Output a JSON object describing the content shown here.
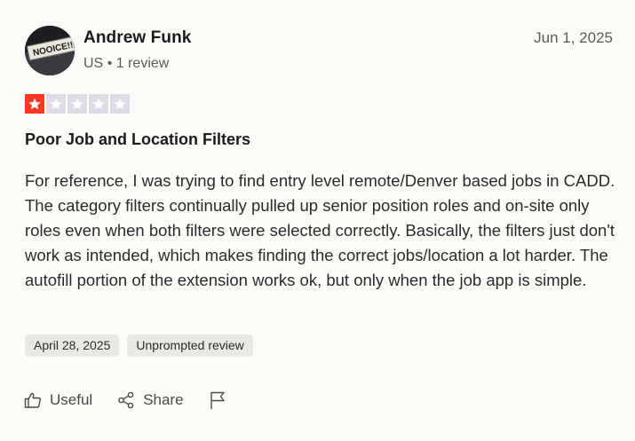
{
  "reviewer": {
    "name": "Andrew Funk",
    "country": "US",
    "separator": "•",
    "review_count": "1 review",
    "avatar_text": "NOOICE!!"
  },
  "review": {
    "date": "Jun 1, 2025",
    "rating": 1,
    "rating_max": 5,
    "title": "Poor Job and Location Filters",
    "body": "For reference, I was trying to find entry level remote/Denver based jobs in CADD. The category filters continually pulled up senior position roles and on-site only roles even when both filters were selected correctly. Basically, the filters just don't work as intended, which makes finding the correct jobs/location a lot harder. The autofill portion of the extension works ok, but only when the job app is simple.",
    "tags": [
      "April 28, 2025",
      "Unprompted review"
    ]
  },
  "actions": {
    "useful_label": "Useful",
    "share_label": "Share"
  },
  "colors": {
    "star_filled": "#ff3722",
    "star_empty": "#dcdce6",
    "background": "#fcfbf8"
  },
  "icons": [
    "thumbs-up-icon",
    "share-icon",
    "flag-icon",
    "star-icon"
  ]
}
